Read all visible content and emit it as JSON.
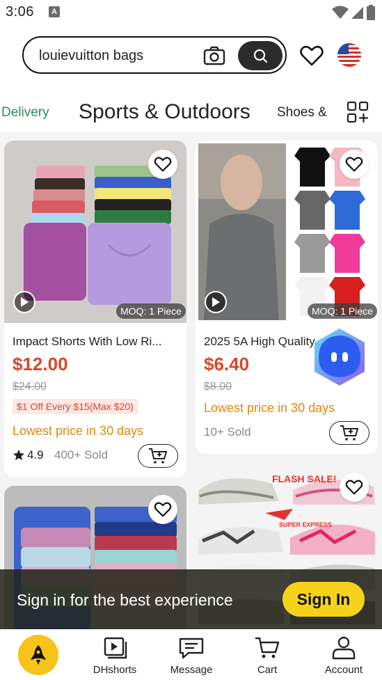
{
  "status_bar": {
    "time": "3:06",
    "notification_icon": "A"
  },
  "search": {
    "query": "louievuitton bags"
  },
  "categories": {
    "items": [
      "Delivery",
      "Sports & Outdoors",
      "Shoes &"
    ],
    "active": "Sports & Outdoors"
  },
  "products": [
    {
      "title": "Impact Shorts With Low Ri...",
      "price": "$12.00",
      "old_price": "$24.00",
      "coupon": "$1 Off Every $15(Max $20)",
      "lowest": "Lowest price in 30 days",
      "rating": "4.9",
      "sold": "400+ Sold",
      "moq": "MOQ: 1 Piece"
    },
    {
      "title": "2025 5A High Quality ...",
      "price": "$6.40",
      "old_price": "$8.00",
      "lowest": "Lowest price in 30 days",
      "sold": "10+ Sold",
      "moq": "MOQ: 1 Piece"
    }
  ],
  "shoe_banner": {
    "flash_sale": "FLASH SALE!",
    "super_express": "SUPER EXPRESS"
  },
  "signin_banner": {
    "text": "Sign in for the best experience",
    "button": "Sign In"
  },
  "bottom_nav": [
    {
      "label": "",
      "icon": "rocket-home-icon"
    },
    {
      "label": "DHshorts",
      "icon": "play-square-icon"
    },
    {
      "label": "Message",
      "icon": "message-icon"
    },
    {
      "label": "Cart",
      "icon": "cart-icon"
    },
    {
      "label": "Account",
      "icon": "person-icon"
    }
  ],
  "colors": {
    "price": "#d9472b",
    "accent_yellow": "#f7d21a",
    "delivery_green": "#2f8a55",
    "lowest_orange": "#e4870b"
  }
}
